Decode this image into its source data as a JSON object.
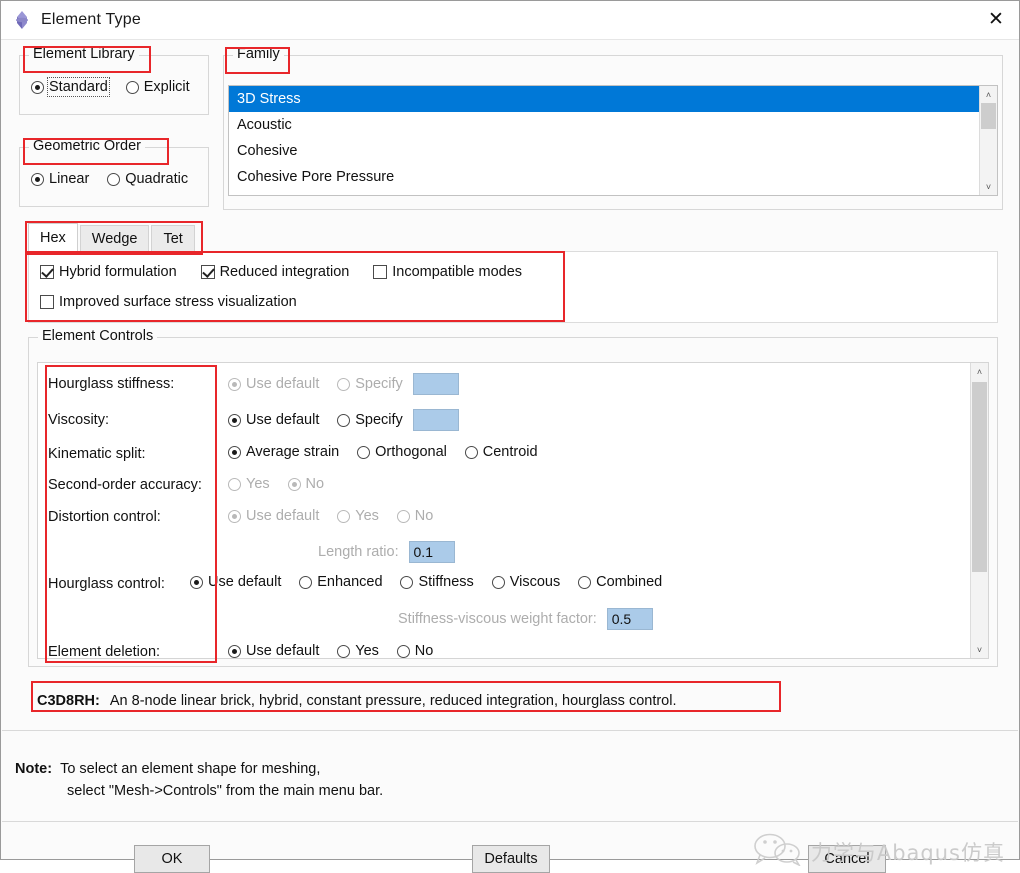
{
  "window": {
    "title": "Element Type",
    "icon": "abaqus-diamond-icon",
    "close_label": "✕"
  },
  "element_library": {
    "title": "Element Library",
    "options": [
      {
        "label": "Standard",
        "selected": true,
        "focused": true
      },
      {
        "label": "Explicit",
        "selected": false,
        "focused": false
      }
    ]
  },
  "geometric_order": {
    "title": "Geometric Order",
    "options": [
      {
        "label": "Linear",
        "selected": true
      },
      {
        "label": "Quadratic",
        "selected": false
      }
    ]
  },
  "family": {
    "title": "Family",
    "items": [
      {
        "label": "3D Stress",
        "selected": true
      },
      {
        "label": "Acoustic",
        "selected": false
      },
      {
        "label": "Cohesive",
        "selected": false
      },
      {
        "label": "Cohesive Pore Pressure",
        "selected": false
      }
    ],
    "scroll_up": "˄",
    "scroll_down": "˅"
  },
  "shape_tabs": [
    {
      "label": "Hex",
      "active": true
    },
    {
      "label": "Wedge",
      "active": false
    },
    {
      "label": "Tet",
      "active": false
    }
  ],
  "formulation_checkboxes": [
    {
      "label": "Hybrid formulation",
      "checked": true
    },
    {
      "label": "Reduced integration",
      "checked": true
    },
    {
      "label": "Incompatible modes",
      "checked": false
    },
    {
      "label": "Improved surface stress visualization",
      "checked": false
    }
  ],
  "element_controls": {
    "title": "Element Controls",
    "scroll_up": "˄",
    "scroll_down": "˅",
    "rows": [
      {
        "label": "Hourglass stiffness:",
        "disabled": true,
        "options": [
          {
            "label": "Use default",
            "selected": true
          },
          {
            "label": "Specify",
            "selected": false
          }
        ],
        "field": ""
      },
      {
        "label": "Viscosity:",
        "disabled": false,
        "options": [
          {
            "label": "Use default",
            "selected": true
          },
          {
            "label": "Specify",
            "selected": false
          }
        ],
        "field": ""
      },
      {
        "label": "Kinematic split:",
        "disabled": false,
        "options": [
          {
            "label": "Average strain",
            "selected": true
          },
          {
            "label": "Orthogonal",
            "selected": false
          },
          {
            "label": "Centroid",
            "selected": false
          }
        ]
      },
      {
        "label": "Second-order accuracy:",
        "disabled": true,
        "options": [
          {
            "label": "Yes",
            "selected": false
          },
          {
            "label": "No",
            "selected": true
          }
        ]
      },
      {
        "label": "Distortion control:",
        "disabled": true,
        "options": [
          {
            "label": "Use default",
            "selected": true
          },
          {
            "label": "Yes",
            "selected": false
          },
          {
            "label": "No",
            "selected": false
          }
        ]
      },
      {
        "label": "",
        "sub_label": "Length ratio:",
        "sub_value": "0.1",
        "disabled": true
      },
      {
        "label": "Hourglass control:",
        "disabled": false,
        "options": [
          {
            "label": "Use default",
            "selected": true
          },
          {
            "label": "Enhanced",
            "selected": false
          },
          {
            "label": "Stiffness",
            "selected": false
          },
          {
            "label": "Viscous",
            "selected": false
          },
          {
            "label": "Combined",
            "selected": false
          }
        ]
      },
      {
        "label": "",
        "sub_label": "Stiffness-viscous weight factor:",
        "sub_value": "0.5",
        "disabled": true
      },
      {
        "label": "Element deletion:",
        "disabled": false,
        "options": [
          {
            "label": "Use default",
            "selected": true
          },
          {
            "label": "Yes",
            "selected": false
          },
          {
            "label": "No",
            "selected": false
          }
        ]
      }
    ]
  },
  "description": {
    "code": "C3D8RH:",
    "text": "An 8-node linear brick, hybrid, constant pressure, reduced integration, hourglass control."
  },
  "note": {
    "prefix": "Note:",
    "line1": "To select an element shape for meshing,",
    "line2": "select \"Mesh->Controls\" from the main menu bar."
  },
  "buttons": [
    {
      "label": "OK",
      "name": "ok-button"
    },
    {
      "label": "Defaults",
      "name": "defaults-button"
    },
    {
      "label": "Cancel",
      "name": "cancel-button"
    }
  ],
  "watermark": {
    "text": "力学与Abaqus仿真"
  },
  "colors": {
    "selection_blue": "#0078d7",
    "field_blue": "#abcbe9",
    "annotation_red": "#e8262a"
  }
}
